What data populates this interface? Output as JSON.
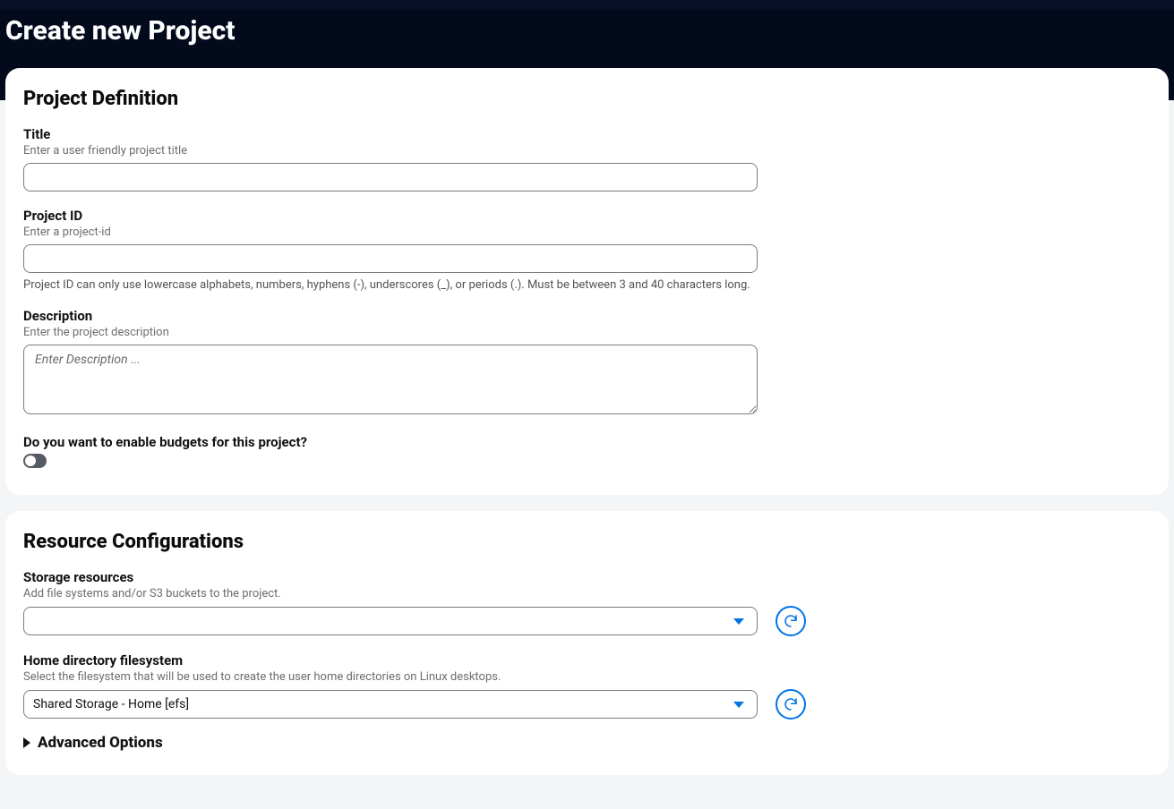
{
  "page": {
    "title": "Create new Project"
  },
  "definition": {
    "section_title": "Project Definition",
    "title_field": {
      "label": "Title",
      "hint": "Enter a user friendly project title",
      "value": ""
    },
    "project_id_field": {
      "label": "Project ID",
      "hint": "Enter a project-id",
      "value": "",
      "note": "Project ID can only use lowercase alphabets, numbers, hyphens (-), underscores (_), or periods (.). Must be between 3 and 40 characters long."
    },
    "description_field": {
      "label": "Description",
      "hint": "Enter the project description",
      "placeholder": "Enter Description ...",
      "value": ""
    },
    "budgets_field": {
      "label": "Do you want to enable budgets for this project?",
      "enabled": false
    }
  },
  "resources": {
    "section_title": "Resource Configurations",
    "storage_field": {
      "label": "Storage resources",
      "hint": "Add file systems and/or S3 buckets to the project.",
      "value": ""
    },
    "home_dir_field": {
      "label": "Home directory filesystem",
      "hint": "Select the filesystem that will be used to create the user home directories on Linux desktops.",
      "value": "Shared Storage - Home [efs]"
    },
    "advanced_label": "Advanced Options"
  }
}
